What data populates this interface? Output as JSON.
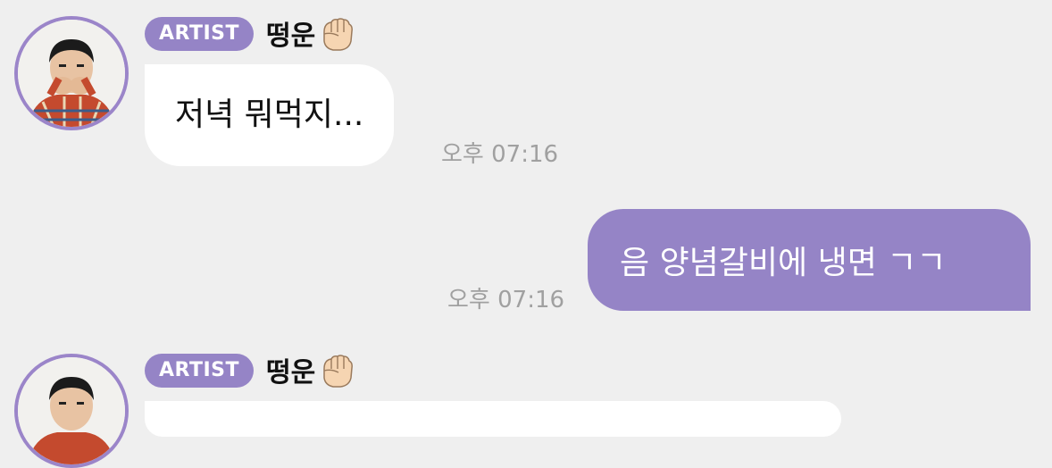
{
  "messages": [
    {
      "direction": "in",
      "badge": "ARTIST",
      "sender": "떵운",
      "sender_emoji": "fist-icon",
      "text": "저녁 뭐먹지...",
      "time": "오후 07:16"
    },
    {
      "direction": "out",
      "text": "음 양념갈비에 냉면 ㄱㄱ",
      "time": "오후 07:16"
    },
    {
      "direction": "in",
      "badge": "ARTIST",
      "sender": "떵운",
      "sender_emoji": "fist-icon"
    }
  ],
  "colors": {
    "background": "#efefef",
    "accent": "#9584c6",
    "avatar_ring": "#9b85c9",
    "incoming_bubble": "#ffffff",
    "timestamp": "#a0a0a0"
  }
}
